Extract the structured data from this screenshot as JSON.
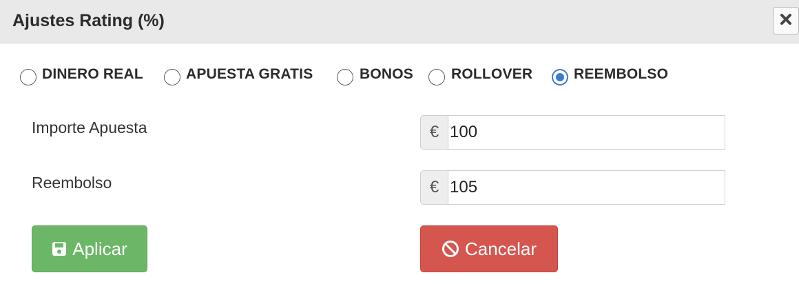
{
  "dialog": {
    "title": "Ajustes Rating (%)",
    "close_icon": "close-icon"
  },
  "bet_types": [
    {
      "label": "DINERO REAL",
      "checked": false
    },
    {
      "label": "APUESTA GRATIS",
      "checked": false
    },
    {
      "label": "BONOS",
      "checked": false
    },
    {
      "label": "ROLLOVER",
      "checked": false
    },
    {
      "label": "REEMBOLSO",
      "checked": true
    }
  ],
  "fields": {
    "stake": {
      "label": "Importe Apuesta",
      "currency": "€",
      "value": "100"
    },
    "refund": {
      "label": "Reembolso",
      "currency": "€",
      "value": "105"
    }
  },
  "buttons": {
    "apply": {
      "label": "Aplicar",
      "icon": "save-icon"
    },
    "cancel": {
      "label": "Cancelar",
      "icon": "ban-icon"
    }
  },
  "colors": {
    "apply_bg": "#6cb767",
    "cancel_bg": "#d4564f",
    "radio_selected": "#3a7bd5",
    "header_bg": "#e9e9e9"
  }
}
